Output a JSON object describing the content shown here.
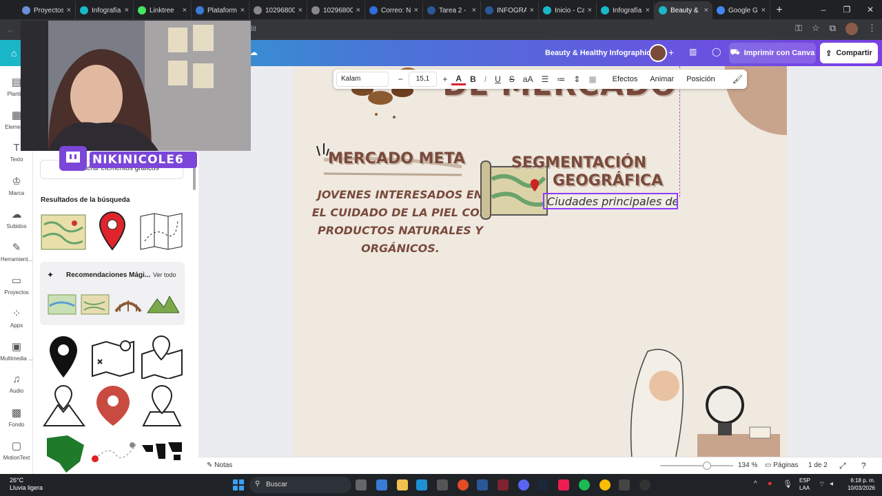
{
  "browser": {
    "tabs": [
      {
        "label": "Proyectos",
        "color": "#6b8fd9"
      },
      {
        "label": "Infografía",
        "color": "#19b8c8"
      },
      {
        "label": "Linktree",
        "color": "#43e660"
      },
      {
        "label": "Plataforma",
        "color": "#3a7bd5"
      },
      {
        "label": "10296800",
        "color": "#888888"
      },
      {
        "label": "10296800",
        "color": "#888888"
      },
      {
        "label": "Correo: N",
        "color": "#2f6fde"
      },
      {
        "label": "Tarea 2 - E",
        "color": "#2b5797"
      },
      {
        "label": "INFOGRAF",
        "color": "#2b5797"
      },
      {
        "label": "Inicio - Ca",
        "color": "#19b8c8"
      },
      {
        "label": "Infografía",
        "color": "#19b8c8"
      },
      {
        "label": "Beauty &",
        "color": "#19b8c8"
      },
      {
        "label": "Google G",
        "color": "#4285f4"
      }
    ],
    "address_text": "lit"
  },
  "header": {
    "doc_title": "Beauty & Healthy Infographic",
    "print_label": "Imprimir con Canva",
    "share_label": "Compartir"
  },
  "rail": {
    "items": [
      {
        "label": "Planti...",
        "icon": "template-icon"
      },
      {
        "label": "Elemen...",
        "icon": "elements-icon"
      },
      {
        "label": "Texto",
        "icon": "text-icon"
      },
      {
        "label": "Marca",
        "icon": "brand-icon"
      },
      {
        "label": "Subidos",
        "icon": "upload-icon"
      },
      {
        "label": "Herramient...",
        "icon": "tools-icon"
      },
      {
        "label": "Proyectos",
        "icon": "folder-icon"
      },
      {
        "label": "Apps",
        "icon": "apps-icon"
      },
      {
        "label": "Multimedia ...",
        "icon": "media-icon"
      },
      {
        "label": "Audio",
        "icon": "audio-icon"
      },
      {
        "label": "Fondo",
        "icon": "background-icon"
      },
      {
        "label": "MotionText",
        "icon": "motiontext-icon"
      }
    ]
  },
  "panel": {
    "generate_label": "enerar elementos gráficos",
    "results_heading": "Resultados de la búsqueda",
    "recos_title": "Recomendaciones Mági...",
    "recos_more": "Ver todo"
  },
  "toolbar": {
    "font": "Kalam",
    "size": "15,1",
    "effects": "Efectos",
    "animate": "Animar",
    "position": "Posición"
  },
  "canvas": {
    "main_title": "DE MERCADO",
    "meta_title": "MERCADO META",
    "meta_line1": "JOVENES INTERESADOS EN",
    "meta_line2": "EL CUIDADO DE LA PIEL CON",
    "meta_line3": "PRODUCTOS NATURALES Y",
    "meta_line4": "ORGÁNICOS.",
    "seg_title1": "SEGMENTACIÓN",
    "seg_title2": "GEOGRÁFICA",
    "selected_text": "Ciudades principales de"
  },
  "bottom": {
    "notes": "Notas",
    "zoom": "134 %",
    "pages": "Páginas",
    "page_count": "1 de 2"
  },
  "stream": {
    "channel": "NIKINICOLE6"
  },
  "taskbar": {
    "temp": "26°C",
    "weather": "Lluvia ligera",
    "search": "Buscar",
    "lang1": "ESP",
    "lang2": "LAA",
    "time": "6:18 p. m.",
    "date": "10/03/2026"
  }
}
